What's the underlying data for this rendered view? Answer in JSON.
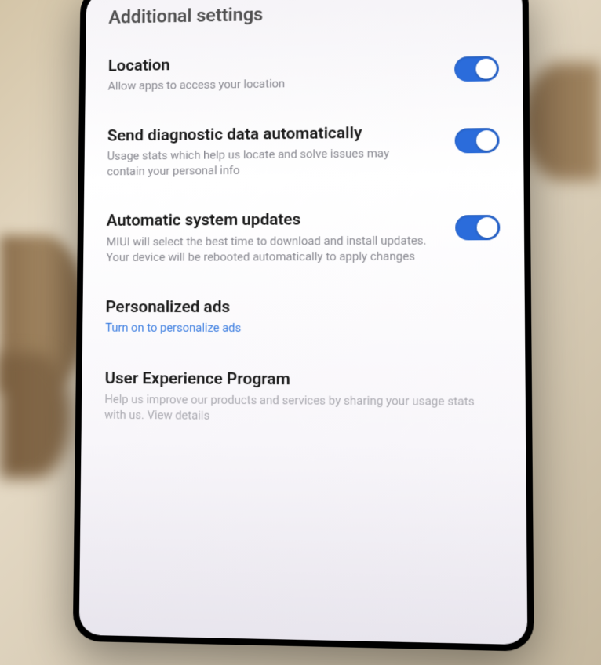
{
  "page": {
    "title": "Additional settings"
  },
  "settings": {
    "location": {
      "title": "Location",
      "subtitle": "Allow apps to access your location",
      "enabled": true
    },
    "diagnostics": {
      "title": "Send diagnostic data automatically",
      "subtitle": "Usage stats which help us locate and solve issues may contain your personal info",
      "enabled": true
    },
    "updates": {
      "title": "Automatic system updates",
      "subtitle": "MIUI will select the best time to download and install updates. Your device will be rebooted automatically to apply changes",
      "enabled": true
    },
    "ads": {
      "title": "Personalized ads",
      "subtitle": "Turn on to personalize ads"
    },
    "uep": {
      "title": "User Experience Program",
      "subtitle": "Help us improve our products and services by sharing your usage stats with us. View details"
    }
  }
}
